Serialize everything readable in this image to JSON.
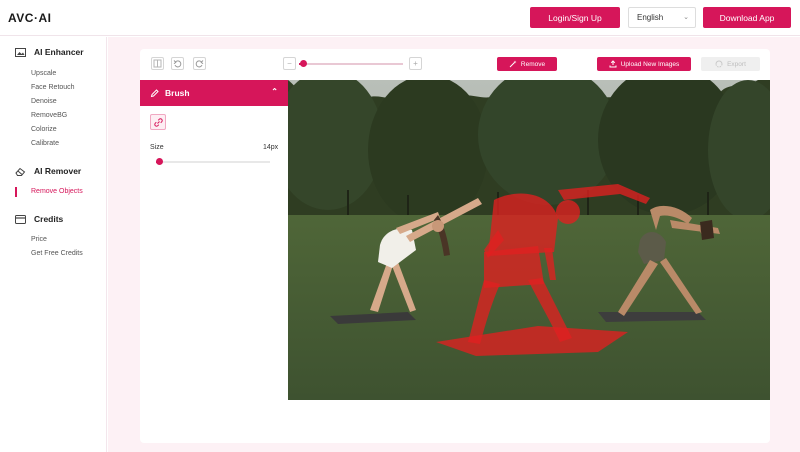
{
  "header": {
    "logo": "AVC·AI",
    "login_label": "Login/Sign Up",
    "language": "English",
    "download_label": "Download App"
  },
  "sidebar": {
    "sections": [
      {
        "title": "AI Enhancer",
        "icon": "image-icon",
        "items": [
          "Upscale",
          "Face Retouch",
          "Denoise",
          "RemoveBG",
          "Colorize",
          "Calibrate"
        ]
      },
      {
        "title": "AI Remover",
        "icon": "eraser-icon",
        "items": [
          "Remove Objects"
        ],
        "active_item": "Remove Objects"
      },
      {
        "title": "Credits",
        "icon": "credit-card-icon",
        "items": [
          "Price",
          "Get Free Credits"
        ]
      }
    ]
  },
  "toolbar": {
    "zoom_minus": "−",
    "zoom_plus": "+",
    "zoom_level_fraction": 0.04,
    "remove_label": "Remove",
    "upload_label": "Upload New Images",
    "export_label": "Export"
  },
  "brush_panel": {
    "title": "Brush",
    "size_label": "Size",
    "size_value": "14px",
    "size_fraction": 0.03
  },
  "colors": {
    "accent": "#d6165a",
    "background_tint": "#fdf1f5",
    "mask": "#e02020"
  }
}
